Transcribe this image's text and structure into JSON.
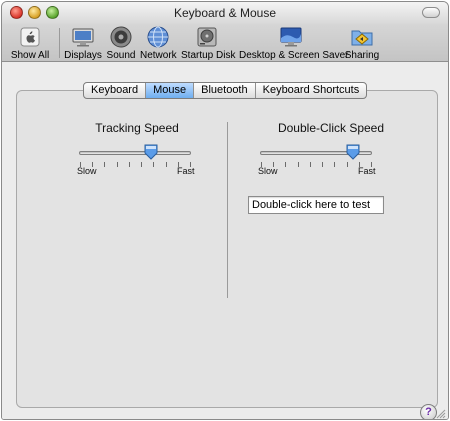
{
  "window": {
    "title": "Keyboard & Mouse"
  },
  "toolbar": {
    "items": [
      {
        "label": "Show All",
        "icon": "apple-grid-icon"
      },
      {
        "label": "Displays",
        "icon": "monitor-icon"
      },
      {
        "label": "Sound",
        "icon": "speaker-icon"
      },
      {
        "label": "Network",
        "icon": "globe-icon"
      },
      {
        "label": "Startup Disk",
        "icon": "hard-disk-icon"
      },
      {
        "label": "Desktop & Screen Saver",
        "icon": "desktop-icon"
      },
      {
        "label": "Sharing",
        "icon": "sharing-folder-icon"
      }
    ]
  },
  "tabs": [
    {
      "label": "Keyboard",
      "active": false
    },
    {
      "label": "Mouse",
      "active": true
    },
    {
      "label": "Bluetooth",
      "active": false
    },
    {
      "label": "Keyboard Shortcuts",
      "active": false
    }
  ],
  "tracking": {
    "title": "Tracking Speed",
    "slow_label": "Slow",
    "fast_label": "Fast",
    "value": 0.65
  },
  "double_click": {
    "title": "Double-Click Speed",
    "slow_label": "Slow",
    "fast_label": "Fast",
    "value": 0.85,
    "test_text": "Double-click here to test"
  },
  "help_label": "?",
  "colors": {
    "active_tab": "#6faef0",
    "thumb": "#5b9ce8",
    "help_mark": "#6a2aa8"
  }
}
